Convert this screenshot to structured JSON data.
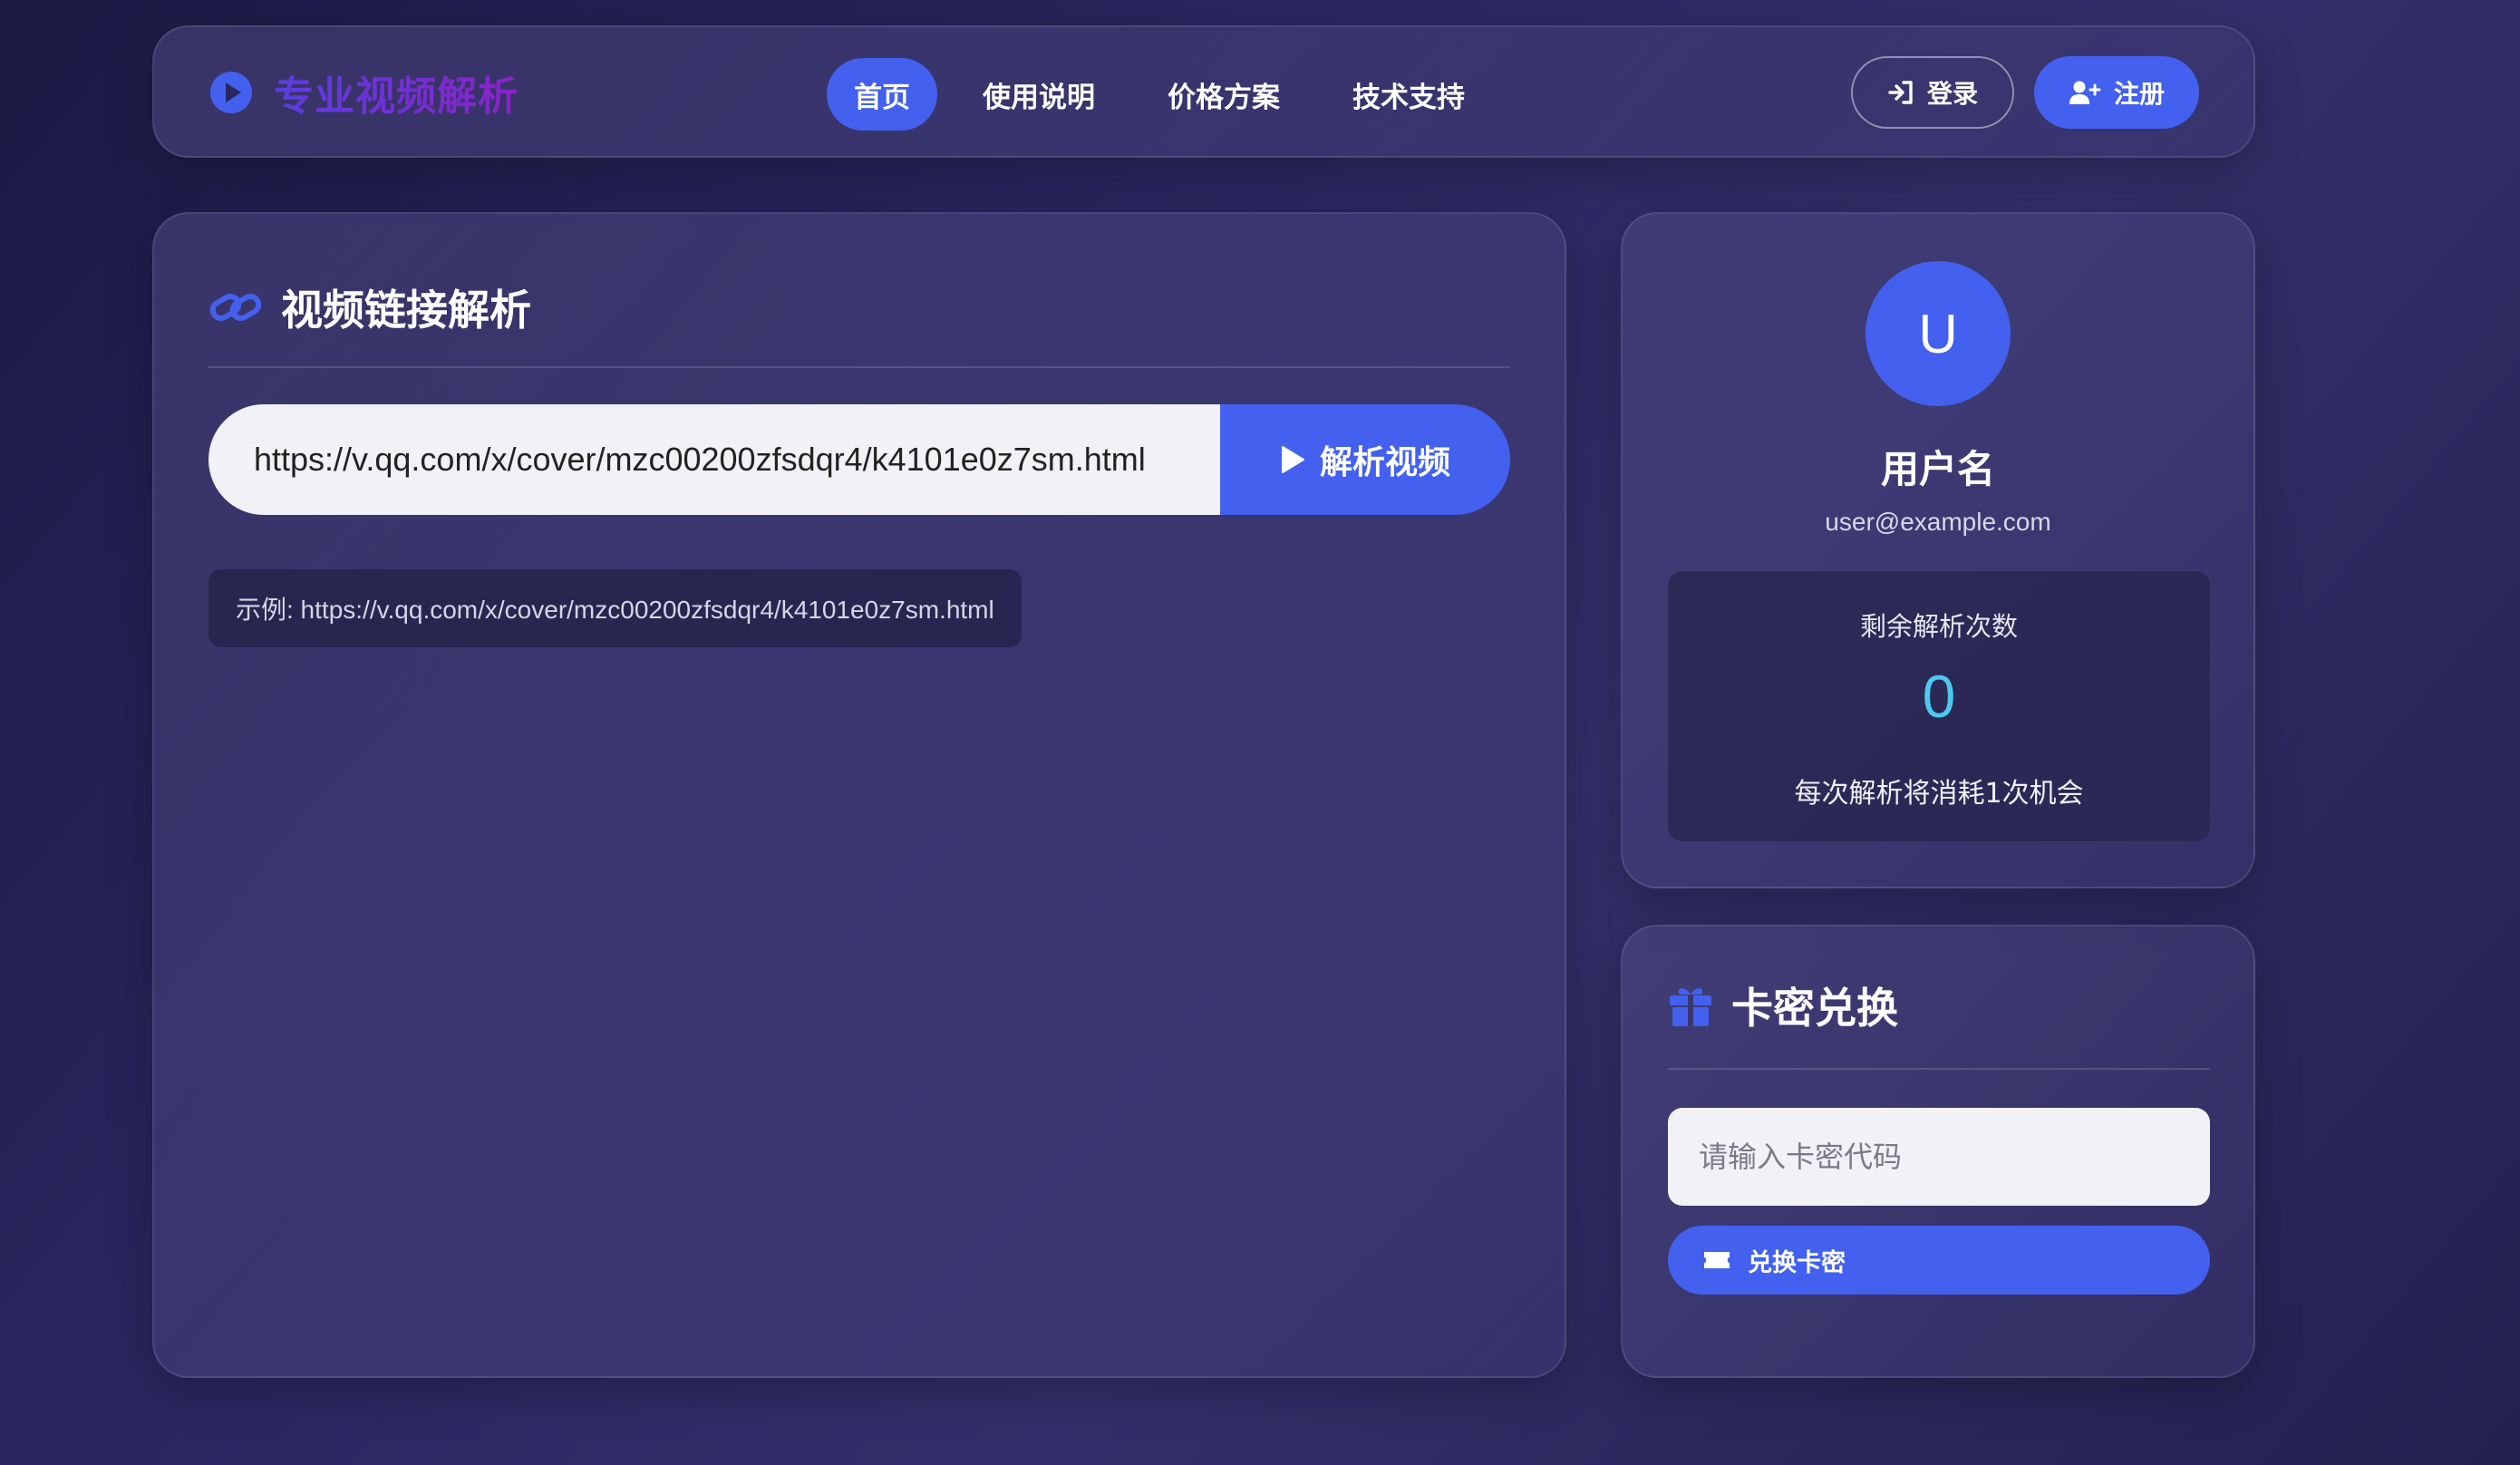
{
  "brand": {
    "title": "专业视频解析",
    "icon": "play-circle-icon",
    "accent": "#4361ee"
  },
  "nav": {
    "items": [
      {
        "label": "首页",
        "active": true
      },
      {
        "label": "使用说明",
        "active": false
      },
      {
        "label": "价格方案",
        "active": false
      },
      {
        "label": "技术支持",
        "active": false
      }
    ]
  },
  "auth": {
    "login_label": "登录",
    "register_label": "注册"
  },
  "parser": {
    "title": "视频链接解析",
    "title_icon": "link-icon",
    "url_value": "https://v.qq.com/x/cover/mzc00200zfsdqr4/k4101e0z7sm.html",
    "button_label": "解析视频",
    "example": "示例: https://v.qq.com/x/cover/mzc00200zfsdqr4/k4101e0z7sm.html"
  },
  "user": {
    "avatar_letter": "U",
    "name": "用户名",
    "email": "user@example.com",
    "quota_label": "剩余解析次数",
    "quota_value": "0",
    "quota_note": "每次解析将消耗1次机会",
    "quota_color": "#4cc9f0"
  },
  "redeem": {
    "title": "卡密兑换",
    "title_icon": "gift-icon",
    "placeholder": "请输入卡密代码",
    "button_label": "兑换卡密",
    "button_icon": "ticket-icon"
  }
}
